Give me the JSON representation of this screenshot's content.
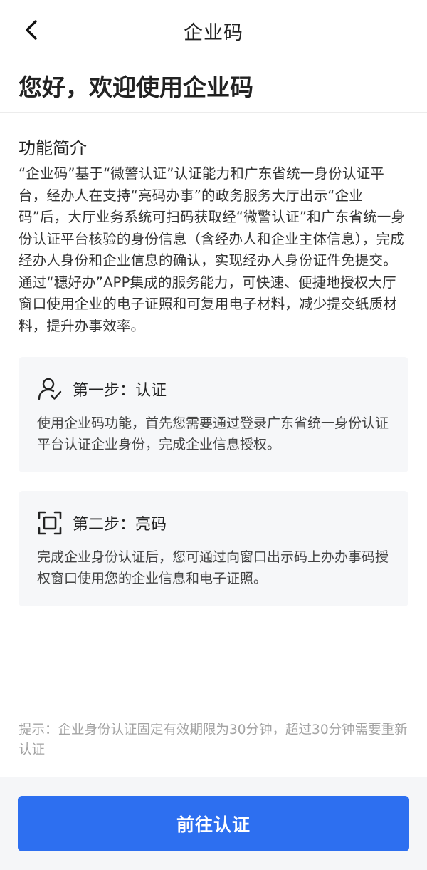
{
  "header": {
    "title": "企业码",
    "back_icon": "chevron-left-icon"
  },
  "welcome": {
    "title": "您好，欢迎使用企业码"
  },
  "intro": {
    "heading": "功能简介",
    "text": "“企业码”基于“微警认证”认证能力和广东省统一身份认证平台，经办人在支持“亮码办事”的政务服务大厅出示“企业码”后，大厅业务系统可扫码获取经“微警认证”和广东省统一身份认证平台核验的身份信息（含经办人和企业主体信息），完成经办人身份和企业信息的确认，实现经办人身份证件免提交。通过“穗好办”APP集成的服务能力，可快速、便捷地授权大厅窗口使用企业的电子证照和可复用电子材料，减少提交纸质材料，提升办事效率。"
  },
  "steps": [
    {
      "icon": "user-check-icon",
      "title": "第一步：认证",
      "text": "使用企业码功能，首先您需要通过登录广东省统一身份认证平台认证企业身份，完成企业信息授权。"
    },
    {
      "icon": "scan-frame-icon",
      "title": "第二步：亮码",
      "text": "完成企业身份认证后，您可通过向窗口出示码上办办事码授权窗口使用您的企业信息和电子证照。"
    }
  ],
  "tip": {
    "text": "提示：企业身份认证固定有效期限为30分钟，超过30分钟需要重新认证"
  },
  "footer": {
    "button_label": "前往认证"
  },
  "colors": {
    "accent": "#2d6ff0",
    "card_bg": "#f6f7f9",
    "tip_text": "#a3a3a3"
  }
}
